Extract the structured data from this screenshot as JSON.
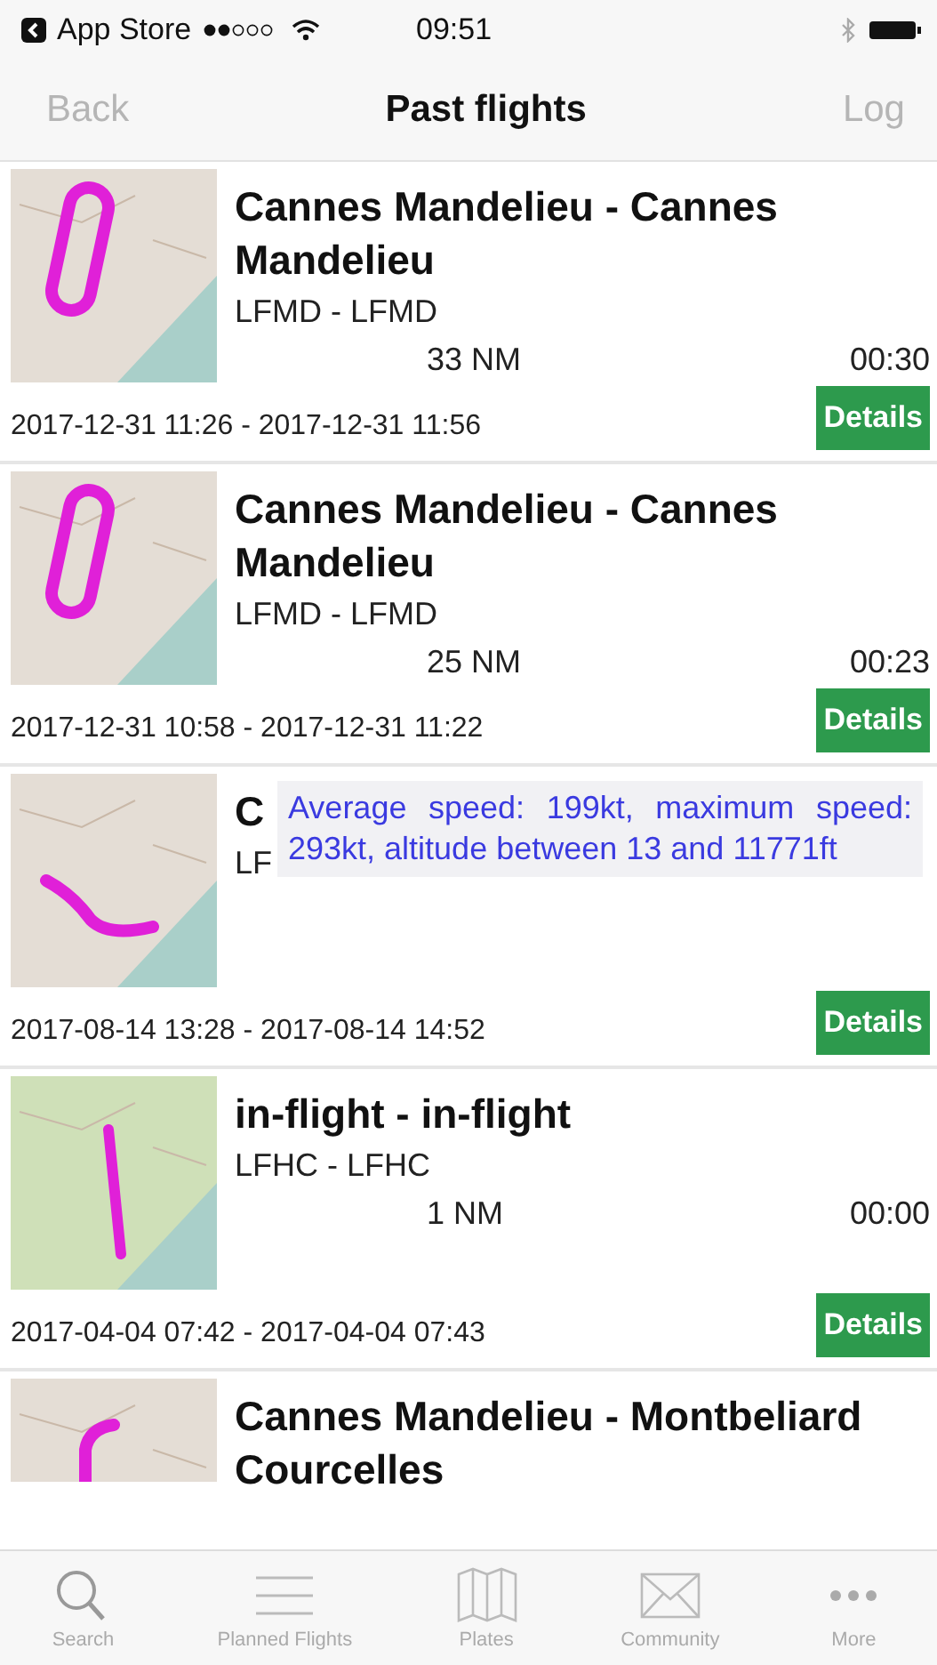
{
  "status_bar": {
    "back_app": "App Store",
    "time": "09:51"
  },
  "nav_bar": {
    "back": {
      "label": "Back",
      "disabled": true
    },
    "title": "Past flights",
    "action": {
      "label": "Log",
      "disabled": true
    }
  },
  "flights": [
    {
      "kind": "loop",
      "title": "Cannes Mandelieu - Cannes Mandelieu",
      "route": "LFMD - LFMD",
      "distance": "33 NM",
      "duration": "00:30",
      "period": "2017-12-31 11:26  - 2017-12-31 11:56",
      "button": "Details"
    },
    {
      "kind": "loop",
      "title": "Cannes Mandelieu - Cannes Mandelieu",
      "route": "LFMD - LFMD",
      "distance": "25 NM",
      "duration": "00:23",
      "period": "2017-12-31 10:58  - 2017-12-31 11:22",
      "button": "Details"
    },
    {
      "kind": "curve",
      "title": "C",
      "route": "LF",
      "period": "2017-08-14 13:28  - 2017-08-14 14:52",
      "button": "Details",
      "tooltip": "Average speed: 199kt, maximum speed: 293kt, altitude between 13 and 11771ft"
    },
    {
      "kind": "line",
      "title": "in-flight - in-flight",
      "route": "LFHC - LFHC",
      "distance": "1 NM",
      "duration": "00:00",
      "period": "2017-04-04 07:42  - 2017-04-04 07:43",
      "button": "Details"
    },
    {
      "kind": "hook",
      "title": "Cannes Mandelieu - Montbeliard Courcelles"
    }
  ],
  "tab_bar": [
    {
      "label": "Search",
      "selected": false
    },
    {
      "label": "Planned Flights",
      "selected": false
    },
    {
      "label": "Plates",
      "selected": false
    },
    {
      "label": "Community",
      "selected": false
    },
    {
      "label": "More",
      "selected": false
    }
  ]
}
